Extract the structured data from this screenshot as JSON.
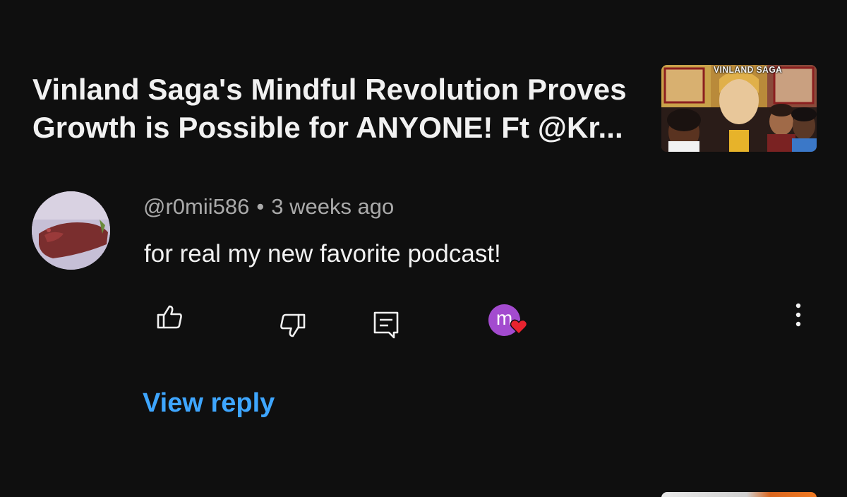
{
  "video": {
    "title": "Vinland Saga's Mindful Revolution Proves Growth is Possible for ANYONE! Ft @Kr...",
    "thumbnail_text": "VINLAND SAGA"
  },
  "comment": {
    "author": "@r0mii586",
    "separator": "•",
    "time_ago": "3 weeks ago",
    "text": "for real my new favorite podcast!",
    "creator_avatar_letter": "m"
  },
  "actions": {
    "like_icon": "thumbs-up-icon",
    "dislike_icon": "thumbs-down-icon",
    "reply_icon": "comment-icon",
    "creator_heart_icon": "heart-icon",
    "more_icon": "more-vertical-icon"
  },
  "replies": {
    "view_label": "View reply"
  },
  "colors": {
    "background": "#0f0f0f",
    "link": "#3ea6ff",
    "heart": "#e8232f",
    "creator_avatar": "#a34bcf"
  }
}
